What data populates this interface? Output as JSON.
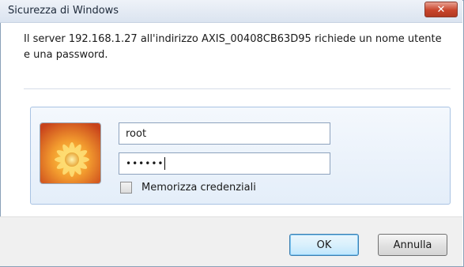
{
  "window": {
    "title": "Sicurezza di Windows",
    "close_label": "✕"
  },
  "message": "Il server 192.168.1.27 all'indirizzo AXIS_00408CB63D95 richiede un nome utente e una password.",
  "credentials": {
    "username_value": "root",
    "password_mask": "••••••",
    "remember_label": "Memorizza credenziali",
    "remember_checked": false
  },
  "buttons": {
    "ok_label": "OK",
    "cancel_label": "Annulla"
  },
  "colors": {
    "accent": "#3c7fb1",
    "panel_border": "#a9c3e3",
    "close_red": "#c8452c"
  },
  "icons": {
    "user_tile": "user-tile-flower-icon"
  }
}
